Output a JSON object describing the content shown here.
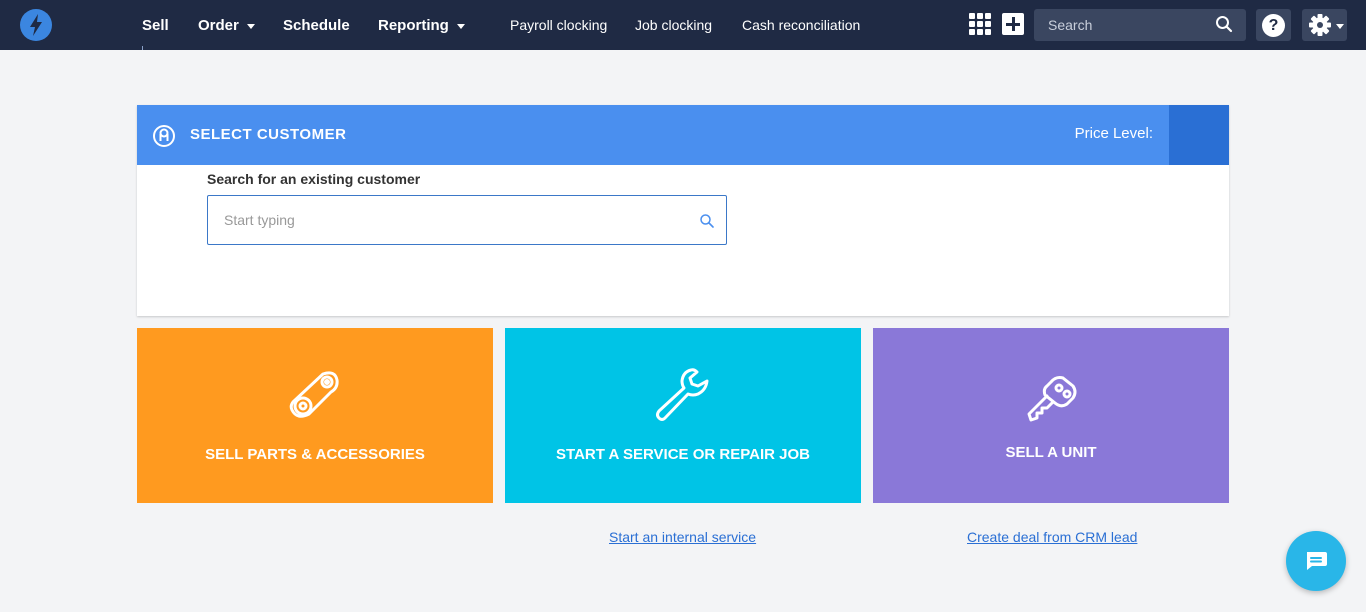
{
  "nav": {
    "main": [
      {
        "label": "Sell",
        "dropdown": false
      },
      {
        "label": "Order",
        "dropdown": true
      },
      {
        "label": "Schedule",
        "dropdown": false
      },
      {
        "label": "Reporting",
        "dropdown": true
      }
    ],
    "sub": [
      {
        "label": "Payroll clocking"
      },
      {
        "label": "Job clocking"
      },
      {
        "label": "Cash reconciliation"
      }
    ],
    "search_placeholder": "Search",
    "help_label": "?",
    "icons": [
      "apps-grid-icon",
      "plus-icon",
      "search-icon",
      "help-icon",
      "gear-icon"
    ]
  },
  "customer": {
    "title": "SELECT CUSTOMER",
    "price_level_label": "Price Level:",
    "search_label": "Search for an existing customer",
    "search_placeholder": "Start typing"
  },
  "tiles": [
    {
      "label": "SELL PARTS & ACCESSORIES",
      "color": "#ff9a1f",
      "icon": "parts-chain-icon"
    },
    {
      "label": "START A SERVICE OR REPAIR JOB",
      "color": "#00c4e6",
      "icon": "wrench-icon"
    },
    {
      "label": "SELL A UNIT",
      "color": "#8a78d8",
      "icon": "key-icon"
    }
  ],
  "links": {
    "internal_service": "Start an internal service",
    "crm_deal": "Create deal from CRM lead"
  },
  "colors": {
    "topbar": "#1f2a44",
    "header_blue": "#4a8fef",
    "link_blue": "#2a6fd4"
  }
}
